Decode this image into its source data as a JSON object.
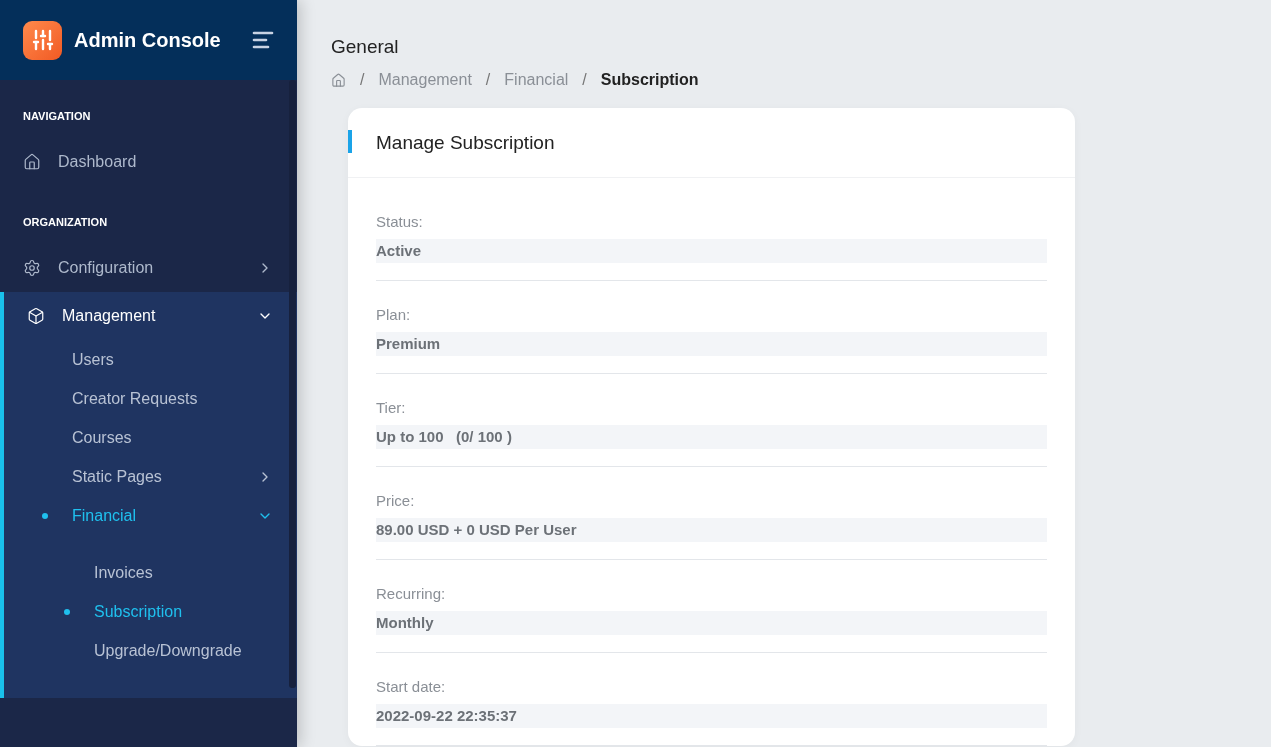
{
  "sidebar": {
    "brand": "Admin Console",
    "sections": [
      {
        "heading": "NAVIGATION",
        "items": [
          {
            "label": "Dashboard",
            "kind": "home",
            "selected": false
          }
        ]
      },
      {
        "heading": "ORGANIZATION",
        "items": [
          {
            "label": "Configuration",
            "kind": "gear",
            "selected": false,
            "expanded": false
          },
          {
            "label": "Management",
            "kind": "box",
            "selected": true,
            "expanded": true,
            "children": [
              {
                "label": "Users",
                "selected": false
              },
              {
                "label": "Creator Requests",
                "selected": false
              },
              {
                "label": "Courses",
                "selected": false
              },
              {
                "label": "Static Pages",
                "selected": false,
                "expanded": false
              },
              {
                "label": "Financial",
                "selected": true,
                "expanded": true,
                "children": [
                  {
                    "label": "Invoices",
                    "selected": false
                  },
                  {
                    "label": "Subscription",
                    "selected": true
                  },
                  {
                    "label": "Upgrade/Downgrade",
                    "selected": false
                  }
                ]
              }
            ]
          }
        ]
      }
    ]
  },
  "page_title": "General",
  "breadcrumb": {
    "separator": "/",
    "items": [
      "Management",
      "Financial",
      "Subscription"
    ]
  },
  "card": {
    "title": "Manage Subscription",
    "fields": [
      {
        "label": "Status:",
        "value": "Active"
      },
      {
        "label": "Plan:",
        "value": "Premium"
      },
      {
        "label": "Tier:",
        "value": "Up to 100   (0/ 100 )"
      },
      {
        "label": "Price:",
        "value": "89.00 USD + 0 USD Per User"
      },
      {
        "label": "Recurring:",
        "value": "Monthly"
      },
      {
        "label": "Start date:",
        "value": "2022-09-22 22:35:37"
      }
    ]
  }
}
